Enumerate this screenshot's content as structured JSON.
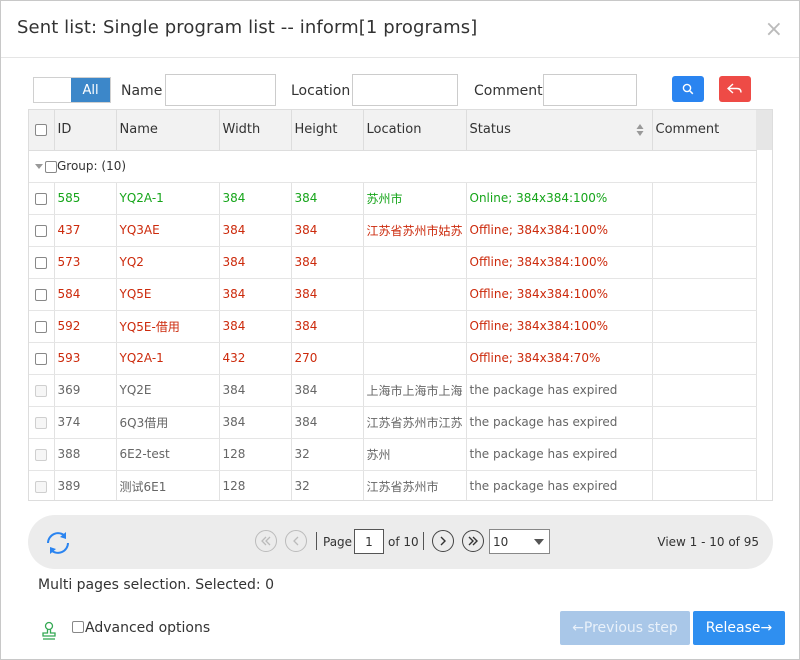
{
  "dialog": {
    "title": "Sent list: Single program list -- inform[1 programs]",
    "close_glyph": "×"
  },
  "filters": {
    "all_label": "All",
    "name_label": "Name",
    "name_value": "",
    "location_label": "Location",
    "location_value": "",
    "comment_label": "Comment",
    "comment_value": "",
    "search_icon": "search-icon",
    "reset_icon": "reset-icon"
  },
  "table": {
    "columns": [
      "ID",
      "Name",
      "Width",
      "Height",
      "Location",
      "Status",
      "Comment"
    ],
    "group_label": "Group: (10)",
    "rows": [
      {
        "id": "585",
        "name": "YQ2A-1",
        "width": "384",
        "height": "384",
        "location": "苏州市",
        "status": "Online; 384x384:100%",
        "comment": "",
        "state": "online"
      },
      {
        "id": "437",
        "name": "YQ3AE",
        "width": "384",
        "height": "384",
        "location": "江苏省苏州市姑苏",
        "status": "Offline; 384x384:100%",
        "comment": "",
        "state": "offline"
      },
      {
        "id": "573",
        "name": "YQ2",
        "width": "384",
        "height": "384",
        "location": "",
        "status": "Offline; 384x384:100%",
        "comment": "",
        "state": "offline"
      },
      {
        "id": "584",
        "name": "YQ5E",
        "width": "384",
        "height": "384",
        "location": "",
        "status": "Offline; 384x384:100%",
        "comment": "",
        "state": "offline"
      },
      {
        "id": "592",
        "name": "YQ5E-借用",
        "width": "384",
        "height": "384",
        "location": "",
        "status": "Offline; 384x384:100%",
        "comment": "",
        "state": "offline"
      },
      {
        "id": "593",
        "name": "YQ2A-1",
        "width": "432",
        "height": "270",
        "location": "",
        "status": "Offline; 384x384:70%",
        "comment": "",
        "state": "offline"
      },
      {
        "id": "369",
        "name": "YQ2E",
        "width": "384",
        "height": "384",
        "location": "上海市上海市上海",
        "status": "the package has expired",
        "comment": "",
        "state": "expired"
      },
      {
        "id": "374",
        "name": "6Q3借用",
        "width": "384",
        "height": "384",
        "location": "江苏省苏州市江苏",
        "status": "the package has expired",
        "comment": "",
        "state": "expired"
      },
      {
        "id": "388",
        "name": "6E2-test",
        "width": "128",
        "height": "32",
        "location": "苏州",
        "status": "the package has expired",
        "comment": "",
        "state": "expired"
      },
      {
        "id": "389",
        "name": "测试6E1",
        "width": "128",
        "height": "32",
        "location": "江苏省苏州市",
        "status": "the package has expired",
        "comment": "",
        "state": "expired"
      }
    ]
  },
  "pager": {
    "page_label": "Page",
    "page_value": "1",
    "of_label": "of 10",
    "page_size": "10",
    "view_text": "View 1 - 10 of 95"
  },
  "footer": {
    "multi_text": "Multi pages selection. Selected: 0",
    "advanced_label": "Advanced options",
    "prev_label": "←Previous step",
    "release_label": "Release→"
  },
  "colors": {
    "online": "#16a51a",
    "offline": "#cc2a0c",
    "expired": "#666666",
    "primary": "#2f8ff0",
    "danger": "#ee4b46"
  }
}
